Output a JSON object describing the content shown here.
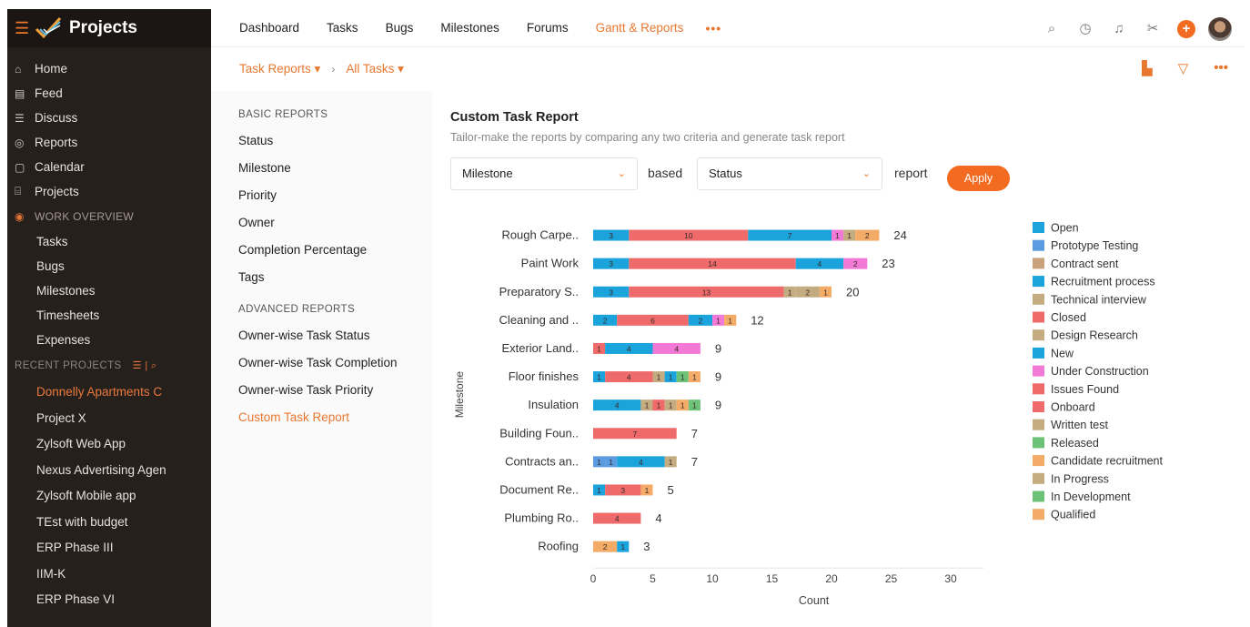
{
  "app": {
    "title": "Projects"
  },
  "sidebar": {
    "items": [
      {
        "label": "Home",
        "icon": "home-icon",
        "glyph": "⌂"
      },
      {
        "label": "Feed",
        "icon": "feed-icon",
        "glyph": "▤"
      },
      {
        "label": "Discuss",
        "icon": "discuss-icon",
        "glyph": "☰"
      },
      {
        "label": "Reports",
        "icon": "reports-icon",
        "glyph": "◎"
      },
      {
        "label": "Calendar",
        "icon": "calendar-icon",
        "glyph": "▢"
      },
      {
        "label": "Projects",
        "icon": "projects-icon",
        "glyph": "⌸"
      }
    ],
    "work_overview_label": "WORK OVERVIEW",
    "work_items": [
      "Tasks",
      "Bugs",
      "Milestones",
      "Timesheets",
      "Expenses"
    ],
    "recent_label": "RECENT PROJECTS",
    "recent_projects": [
      {
        "label": "Donnelly Apartments C",
        "active": true
      },
      {
        "label": "Project X"
      },
      {
        "label": "Zylsoft Web App"
      },
      {
        "label": "Nexus Advertising Agen"
      },
      {
        "label": "Zylsoft Mobile app"
      },
      {
        "label": "TEst with budget"
      },
      {
        "label": "ERP Phase III"
      },
      {
        "label": "IIM-K"
      },
      {
        "label": "ERP Phase VI"
      }
    ]
  },
  "topnav": {
    "items": [
      "Dashboard",
      "Tasks",
      "Bugs",
      "Milestones",
      "Forums",
      "Gantt & Reports"
    ],
    "active": "Gantt & Reports",
    "more": "•••"
  },
  "breadcrumb": {
    "first": "Task Reports",
    "second": "All Tasks"
  },
  "report_nav": {
    "basic_label": "BASIC REPORTS",
    "basic": [
      "Status",
      "Milestone",
      "Priority",
      "Owner",
      "Completion Percentage",
      "Tags"
    ],
    "advanced_label": "ADVANCED REPORTS",
    "advanced": [
      "Owner-wise Task Status",
      "Owner-wise Task Completion",
      "Owner-wise Task Priority",
      "Custom Task Report"
    ],
    "active": "Custom Task Report"
  },
  "report": {
    "title": "Custom Task Report",
    "subtitle": "Tailor-make the reports by comparing any two criteria and generate task report",
    "criteria_1": "Milestone",
    "based_word": "based",
    "criteria_2": "Status",
    "report_word": "report",
    "apply_label": "Apply"
  },
  "colors": {
    "accent": "#f36b21",
    "sidebar_bg": "#26201d"
  },
  "chart_data": {
    "type": "bar",
    "orientation": "horizontal",
    "stacked": true,
    "xlabel": "Count",
    "ylabel": "Milestone",
    "xlim": [
      0,
      32
    ],
    "xticks": [
      0,
      5,
      10,
      15,
      20,
      25,
      30
    ],
    "legend": [
      {
        "name": "Open",
        "color": "#1ba3dc"
      },
      {
        "name": "Prototype Testing",
        "color": "#5b9be0"
      },
      {
        "name": "Contract sent",
        "color": "#c9a27b"
      },
      {
        "name": "Recruitment process",
        "color": "#1ba3dc"
      },
      {
        "name": "Technical interview",
        "color": "#c4ab80"
      },
      {
        "name": "Closed",
        "color": "#ef6b6b"
      },
      {
        "name": "Design Research",
        "color": "#c4ab80"
      },
      {
        "name": "New",
        "color": "#1ba3dc"
      },
      {
        "name": "Under Construction",
        "color": "#f27ad6"
      },
      {
        "name": "Issues Found",
        "color": "#ef6b6b"
      },
      {
        "name": "Onboard",
        "color": "#ef6b6b"
      },
      {
        "name": "Written test",
        "color": "#c4ab80"
      },
      {
        "name": "Released",
        "color": "#6cc276"
      },
      {
        "name": "Candidate recruitment",
        "color": "#f3ab67"
      },
      {
        "name": "In Progress",
        "color": "#c4ab80"
      },
      {
        "name": "In Development",
        "color": "#6cc276"
      },
      {
        "name": "Qualified",
        "color": "#f3ab67"
      }
    ],
    "rows": [
      {
        "label": "Rough Carpe..",
        "total": 24,
        "segments": [
          {
            "value": 3,
            "color": "#1ba3dc"
          },
          {
            "value": 10,
            "color": "#ef6b6b"
          },
          {
            "value": 7,
            "color": "#1ba3dc"
          },
          {
            "value": 1,
            "color": "#f27ad6"
          },
          {
            "value": 1,
            "color": "#c4ab80"
          },
          {
            "value": 2,
            "color": "#f3ab67"
          }
        ]
      },
      {
        "label": "Paint Work",
        "total": 23,
        "segments": [
          {
            "value": 3,
            "color": "#1ba3dc"
          },
          {
            "value": 14,
            "color": "#ef6b6b"
          },
          {
            "value": 4,
            "color": "#1ba3dc"
          },
          {
            "value": 2,
            "color": "#f27ad6"
          }
        ]
      },
      {
        "label": "Preparatory S..",
        "total": 20,
        "segments": [
          {
            "value": 3,
            "color": "#1ba3dc"
          },
          {
            "value": 13,
            "color": "#ef6b6b"
          },
          {
            "value": 1,
            "color": "#c4ab80"
          },
          {
            "value": 2,
            "color": "#c4ab80"
          },
          {
            "value": 1,
            "color": "#f3ab67"
          }
        ]
      },
      {
        "label": "Cleaning and ..",
        "total": 12,
        "segments": [
          {
            "value": 2,
            "color": "#1ba3dc"
          },
          {
            "value": 6,
            "color": "#ef6b6b"
          },
          {
            "value": 2,
            "color": "#1ba3dc"
          },
          {
            "value": 1,
            "color": "#f27ad6"
          },
          {
            "value": 1,
            "color": "#f3ab67"
          }
        ]
      },
      {
        "label": "Exterior Land..",
        "total": 9,
        "segments": [
          {
            "value": 1,
            "color": "#ef6b6b"
          },
          {
            "value": 4,
            "color": "#1ba3dc"
          },
          {
            "value": 4,
            "color": "#f27ad6"
          }
        ]
      },
      {
        "label": "Floor finishes",
        "total": 9,
        "segments": [
          {
            "value": 1,
            "color": "#1ba3dc"
          },
          {
            "value": 4,
            "color": "#ef6b6b"
          },
          {
            "value": 1,
            "color": "#c4ab80"
          },
          {
            "value": 1,
            "color": "#1ba3dc"
          },
          {
            "value": 1,
            "color": "#6cc276"
          },
          {
            "value": 1,
            "color": "#f3ab67"
          }
        ]
      },
      {
        "label": "Insulation",
        "total": 9,
        "segments": [
          {
            "value": 4,
            "color": "#1ba3dc"
          },
          {
            "value": 1,
            "color": "#c4ab80"
          },
          {
            "value": 1,
            "color": "#ef6b6b"
          },
          {
            "value": 1,
            "color": "#c4ab80"
          },
          {
            "value": 1,
            "color": "#f3ab67"
          },
          {
            "value": 1,
            "color": "#6cc276"
          }
        ]
      },
      {
        "label": "Building Foun..",
        "total": 7,
        "segments": [
          {
            "value": 7,
            "color": "#ef6b6b"
          }
        ]
      },
      {
        "label": "Contracts an..",
        "total": 7,
        "segments": [
          {
            "value": 1,
            "color": "#5b9be0"
          },
          {
            "value": 1,
            "color": "#5b9be0"
          },
          {
            "value": 4,
            "color": "#1ba3dc"
          },
          {
            "value": 1,
            "color": "#c4ab80"
          }
        ]
      },
      {
        "label": "Document Re..",
        "total": 5,
        "segments": [
          {
            "value": 1,
            "color": "#1ba3dc"
          },
          {
            "value": 3,
            "color": "#ef6b6b"
          },
          {
            "value": 1,
            "color": "#f3ab67"
          }
        ]
      },
      {
        "label": "Plumbing Ro..",
        "total": 4,
        "segments": [
          {
            "value": 4,
            "color": "#ef6b6b"
          }
        ]
      },
      {
        "label": "Roofing",
        "total": 3,
        "segments": [
          {
            "value": 2,
            "color": "#f3ab67"
          },
          {
            "value": 1,
            "color": "#1ba3dc"
          }
        ]
      }
    ]
  }
}
